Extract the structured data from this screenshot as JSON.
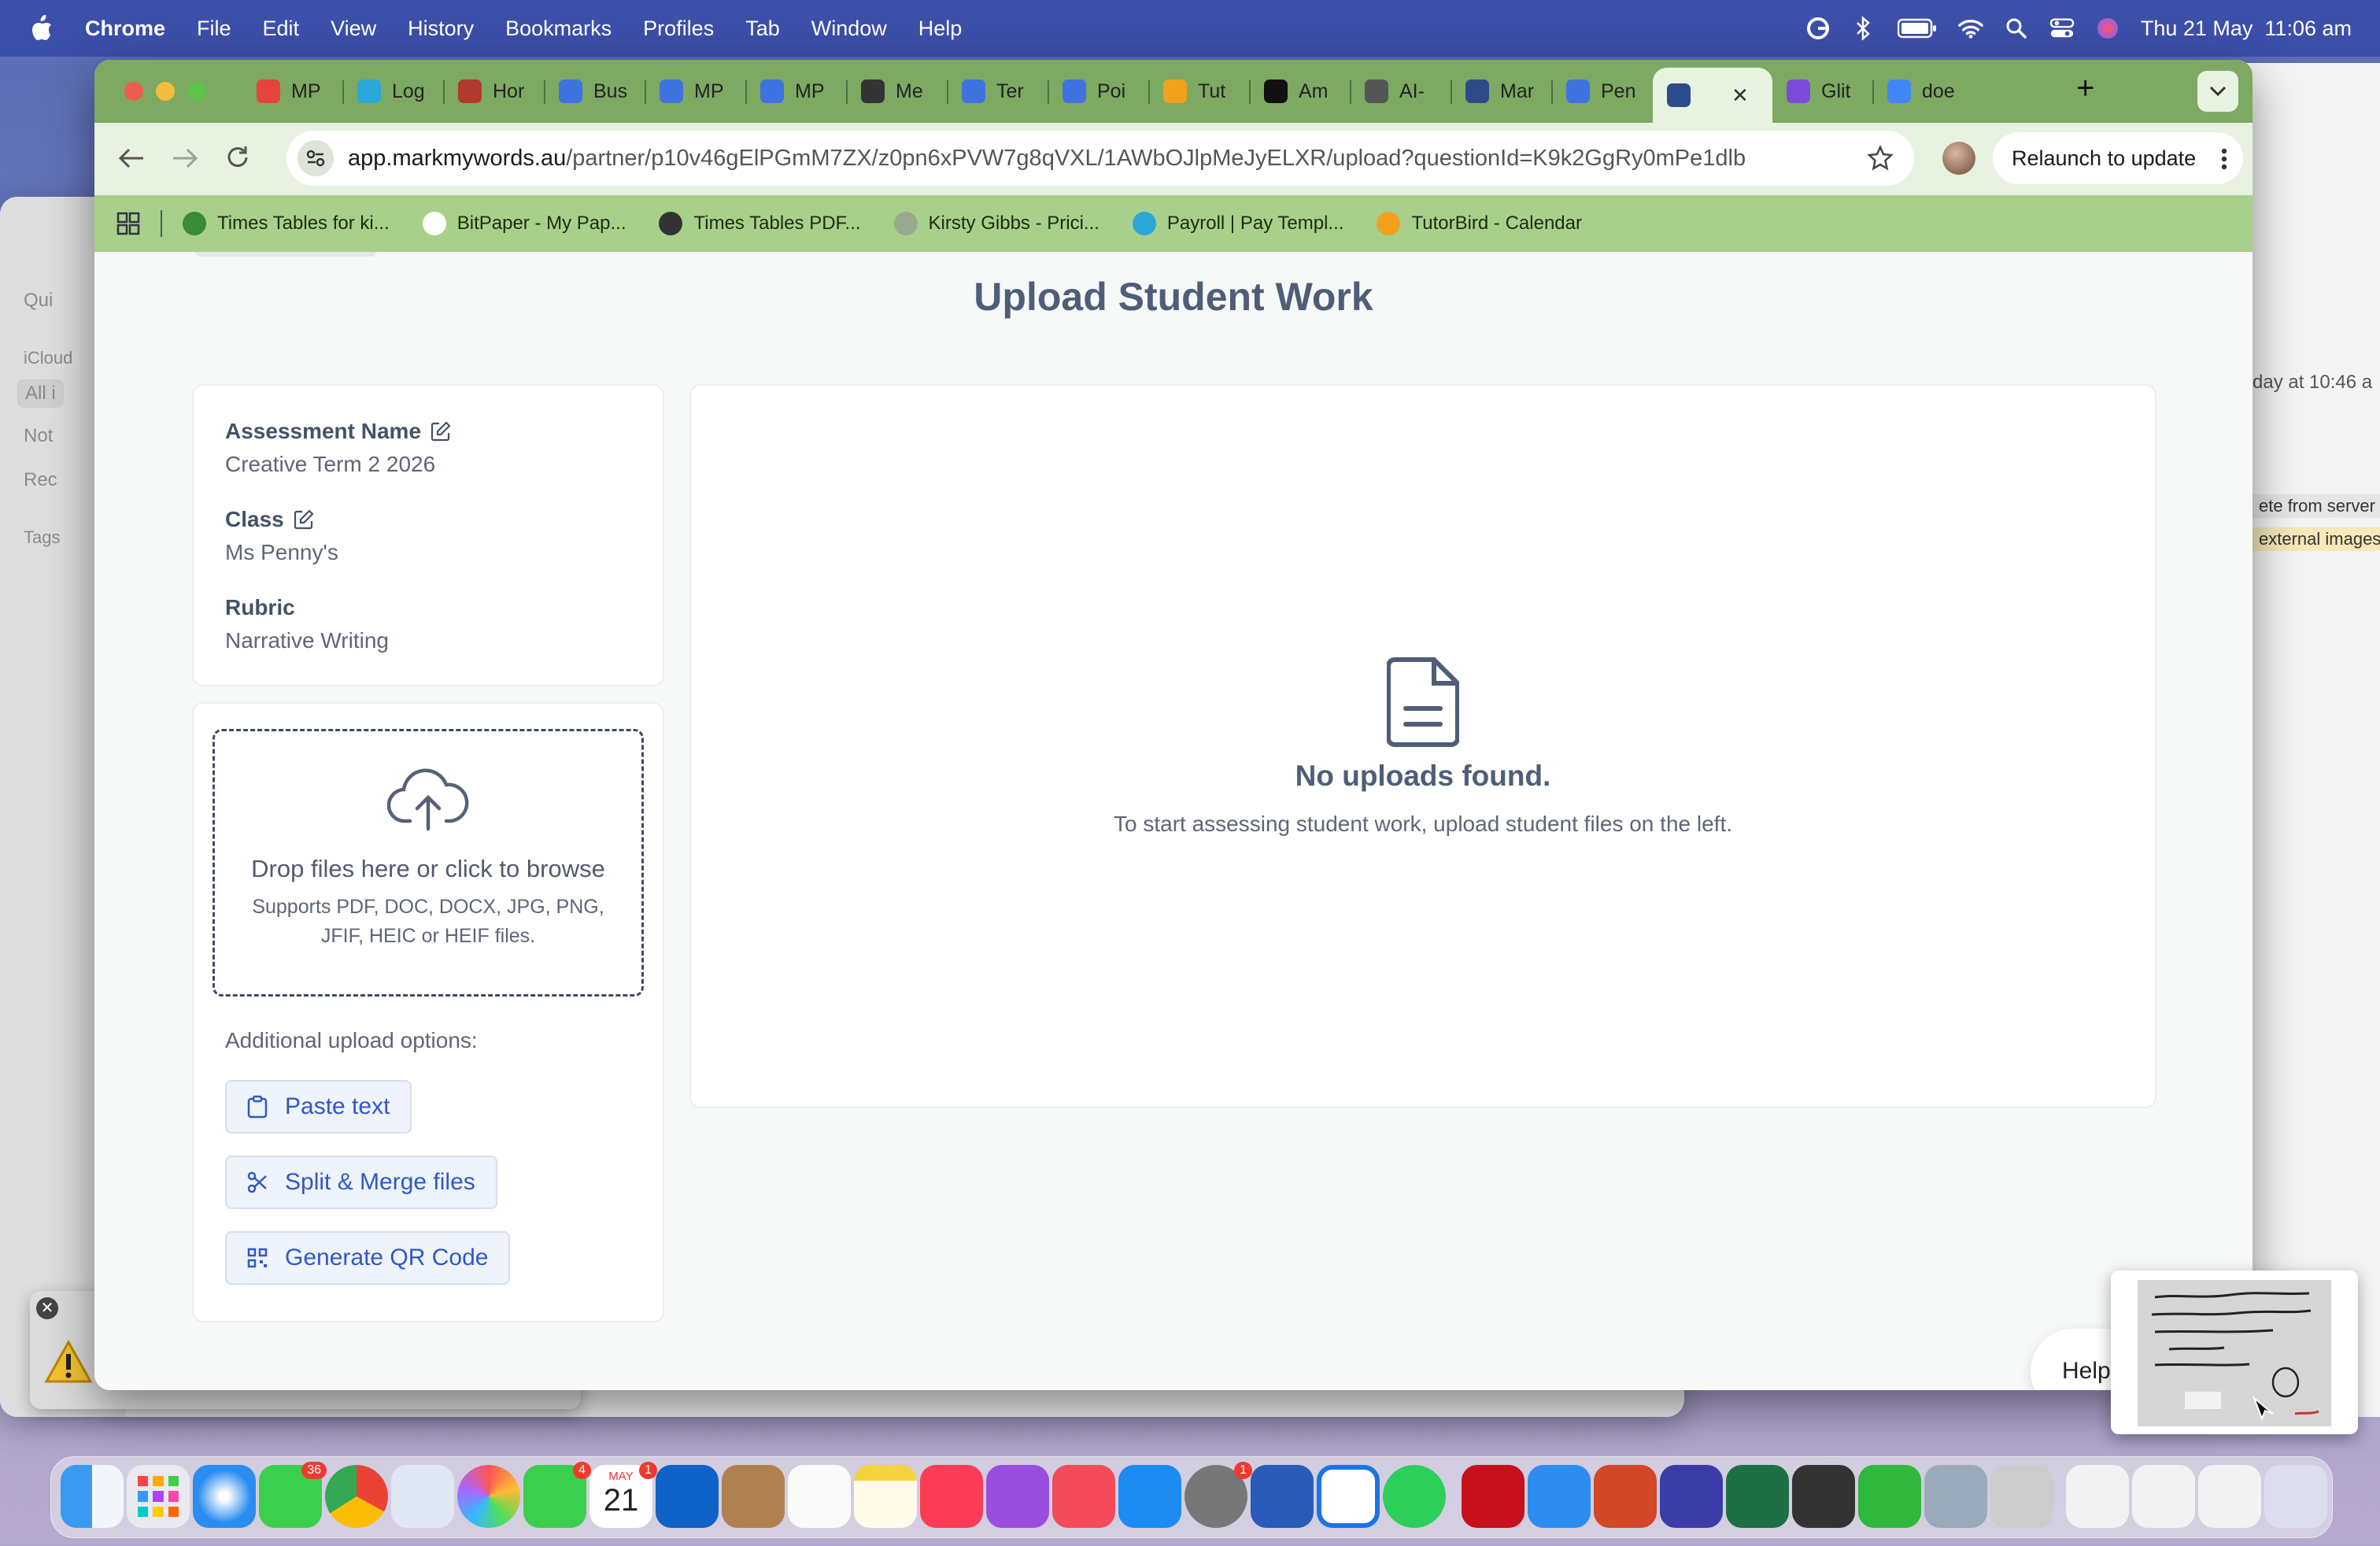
{
  "menubar": {
    "app_name": "Chrome",
    "menus": [
      "File",
      "Edit",
      "View",
      "History",
      "Bookmarks",
      "Profiles",
      "Tab",
      "Window",
      "Help"
    ],
    "clock": "Thu 21 May  11:06 am"
  },
  "tabs": [
    {
      "label": "MP",
      "color": "#e5453c",
      "icon": "calendly-icon"
    },
    {
      "label": "Log",
      "color": "#2aa6d8",
      "icon": "xero-icon"
    },
    {
      "label": "Hor",
      "color": "#b03a2e",
      "icon": "home-icon"
    },
    {
      "label": "Bus",
      "color": "#3f73e0",
      "icon": "docs-icon"
    },
    {
      "label": "MP",
      "color": "#3f73e0",
      "icon": "docs-icon"
    },
    {
      "label": "MP",
      "color": "#3f73e0",
      "icon": "docs-icon"
    },
    {
      "label": "Me",
      "color": "#333333",
      "icon": "chatgpt-icon"
    },
    {
      "label": "Ter",
      "color": "#3f73e0",
      "icon": "docs-icon"
    },
    {
      "label": "Poi",
      "color": "#3f73e0",
      "icon": "docs-icon"
    },
    {
      "label": "Tut",
      "color": "#f2a11d",
      "icon": "tutorbird-icon"
    },
    {
      "label": "Am",
      "color": "#111111",
      "icon": "amazon-icon"
    },
    {
      "label": "AI-",
      "color": "#555555",
      "icon": "script-icon"
    },
    {
      "label": "Mar",
      "color": "#2f4a8a",
      "icon": "markmywords-icon"
    },
    {
      "label": "Pen",
      "color": "#3f73e0",
      "icon": "docs-icon"
    },
    {
      "label": "",
      "color": "#2f4a8a",
      "icon": "markmywords-icon",
      "active": true
    },
    {
      "label": "Glit",
      "color": "#7a4ad8",
      "icon": "glitch-icon"
    },
    {
      "label": "doe",
      "color": "#4285f4",
      "icon": "google-icon"
    }
  ],
  "toolbar": {
    "url_host": "app.markmywords.au",
    "url_path": "/partner/p10v46gElPGmM7ZX/z0pn6xPVW7g8qVXL/1AWbOJlpMeJyELXR/upload?questionId=K9k2GgRy0mPe1dlb",
    "relaunch_label": "Relaunch to update"
  },
  "bookmarks": [
    {
      "label": "Times Tables for ki...",
      "color": "#3a8a3a"
    },
    {
      "label": "BitPaper - My Pap...",
      "color": "#ffffff"
    },
    {
      "label": "Times Tables PDF...",
      "color": "#333333"
    },
    {
      "label": "Kirsty Gibbs - Prici...",
      "color": "#9aa890"
    },
    {
      "label": "Payroll | Pay Templ...",
      "color": "#2aa6d8"
    },
    {
      "label": "TutorBird - Calendar",
      "color": "#f2a11d"
    }
  ],
  "page": {
    "title": "Upload Student Work",
    "assessment_label": "Assessment Name",
    "assessment_value": "Creative Term 2 2026",
    "class_label": "Class",
    "class_value": "Ms Penny's",
    "rubric_label": "Rubric",
    "rubric_value": "Narrative Writing",
    "drop_title": "Drop files here or click to browse",
    "drop_hint_1": "Supports PDF, DOC, DOCX, JPG, PNG,",
    "drop_hint_2": "JFIF, HEIC or HEIF files.",
    "additional_label": "Additional upload options:",
    "paste_text": "Paste text",
    "split_merge": "Split & Merge files",
    "qr_code": "Generate QR Code",
    "empty_title": "No uploads found.",
    "empty_text": "To start assessing student work, upload student files on the left.",
    "help_label": "Help"
  },
  "background": {
    "notes_items": [
      "Qui",
      "iCloud",
      "All i",
      "Not",
      "Rec",
      "Tags"
    ],
    "right_texts": [
      "day at 10:46 a",
      "ete from server",
      "external images"
    ]
  },
  "dock": {
    "messages_badge": "36",
    "facetime_badge": "4",
    "calendar_month": "MAY",
    "calendar_day": "21",
    "calendar_badge": "1",
    "settings_badge": "1"
  }
}
